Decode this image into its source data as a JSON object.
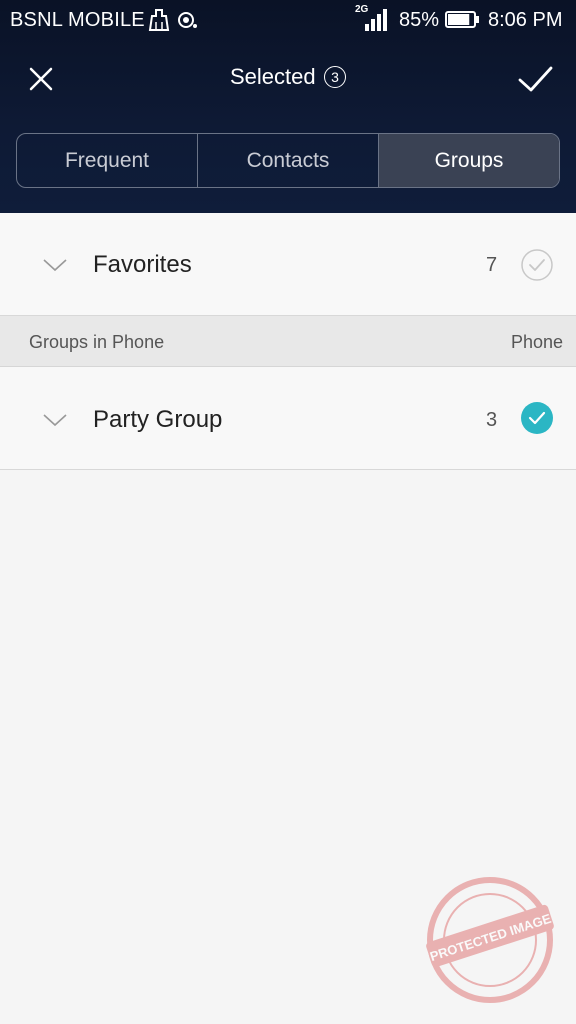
{
  "status_bar": {
    "carrier": "BSNL MOBILE",
    "network_type": "2G",
    "battery_percent": "85%",
    "battery_level": 0.85,
    "time": "8:06 PM",
    "icons": [
      "cleaner-icon",
      "sync-icon",
      "signal-icon",
      "battery-icon"
    ]
  },
  "action_bar": {
    "title": "Selected",
    "selected_count": "3",
    "close_icon": "close-icon",
    "confirm_icon": "check-icon"
  },
  "tabs": [
    {
      "label": "Frequent",
      "active": false
    },
    {
      "label": "Contacts",
      "active": false
    },
    {
      "label": "Groups",
      "active": true
    }
  ],
  "favorites": {
    "label": "Favorites",
    "count": "7",
    "checked": false
  },
  "section": {
    "title": "Groups in Phone",
    "right_label": "Phone"
  },
  "groups": [
    {
      "label": "Party Group",
      "count": "3",
      "checked": true
    }
  ],
  "watermark": {
    "text": "PROTECTED IMAGE"
  },
  "colors": {
    "header_bg": "#0e1a35",
    "accent_teal": "#2bb6c4",
    "active_tab_bg": "#3a4254"
  }
}
